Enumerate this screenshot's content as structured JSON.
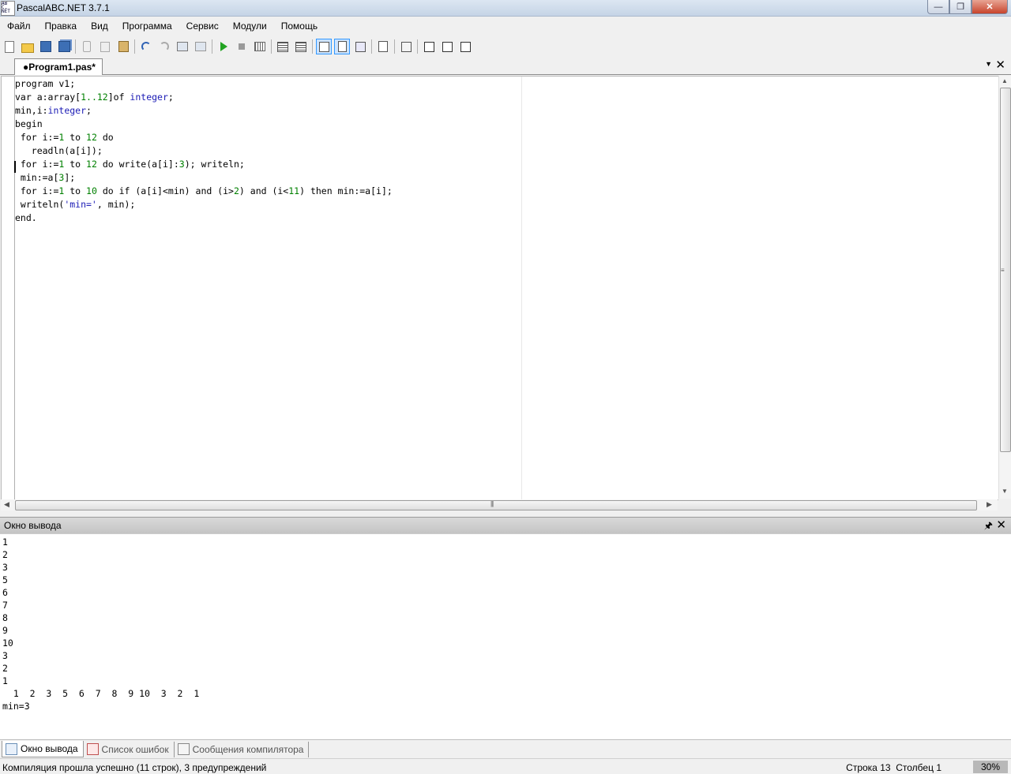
{
  "window": {
    "title": "PascalABC.NET 3.7.1",
    "icon_text": [
      "AB",
      "C.",
      "NET"
    ]
  },
  "menu": [
    "Файл",
    "Правка",
    "Вид",
    "Программа",
    "Сервис",
    "Модули",
    "Помощь"
  ],
  "toolbar": [
    "new-file-icon",
    "open-file-icon",
    "save-icon",
    "save-all-icon",
    "|",
    "cut-icon",
    "copy-icon",
    "paste-icon",
    "|",
    "undo-icon",
    "redo-icon",
    "nav-back-icon",
    "nav-forward-icon",
    "|",
    "run-icon",
    "stop-icon",
    "debug-icon",
    "|",
    "step-over-icon",
    "step-into-icon",
    "|",
    "output-console-icon",
    "output-window-icon",
    "format-code-icon",
    "|",
    "add-watch-icon",
    "|",
    "compile-all-icon",
    "|",
    "tools-1-icon",
    "tools-2-icon",
    "tools-3-icon"
  ],
  "editor": {
    "tab_label": "●Program1.pas*",
    "lines": [
      [
        [
          "program v1;",
          "kw"
        ]
      ],
      [
        [
          "var a:array[",
          "kw"
        ],
        [
          "1..12",
          "nm"
        ],
        [
          "]of ",
          "kw"
        ],
        [
          "integer",
          "ty"
        ],
        [
          ";",
          "kw"
        ]
      ],
      [
        [
          "min,i:",
          "kw"
        ],
        [
          "integer",
          "ty"
        ],
        [
          ";",
          "kw"
        ]
      ],
      [
        [
          "begin",
          "kw"
        ]
      ],
      [
        [
          " for i:=",
          "kw"
        ],
        [
          "1",
          "nm"
        ],
        [
          " to ",
          "kw"
        ],
        [
          "12",
          "nm"
        ],
        [
          " do",
          "kw"
        ]
      ],
      [
        [
          "   readln(a[i]);",
          "kw"
        ]
      ],
      [
        [
          " for i:=",
          "kw"
        ],
        [
          "1",
          "nm"
        ],
        [
          " to ",
          "kw"
        ],
        [
          "12",
          "nm"
        ],
        [
          " do write(a[i]:",
          "kw"
        ],
        [
          "3",
          "nm"
        ],
        [
          "); writeln;",
          "kw"
        ]
      ],
      [
        [
          " min:=a[",
          "kw"
        ],
        [
          "3",
          "nm"
        ],
        [
          "];",
          "kw"
        ]
      ],
      [
        [
          " for i:=",
          "kw"
        ],
        [
          "1",
          "nm"
        ],
        [
          " to ",
          "kw"
        ],
        [
          "10",
          "nm"
        ],
        [
          " do if (a[i]<min) and (i>",
          "kw"
        ],
        [
          "2",
          "nm"
        ],
        [
          ") and (i<",
          "kw"
        ],
        [
          "11",
          "nm"
        ],
        [
          ") then min:=a[i];",
          "kw"
        ]
      ],
      [
        [
          " writeln(",
          "kw"
        ],
        [
          "'min='",
          "st"
        ],
        [
          ", min);",
          "kw"
        ]
      ],
      [
        [
          "end.",
          "kw"
        ]
      ],
      [
        [
          "",
          "kw"
        ]
      ],
      [
        [
          "",
          "kw"
        ]
      ]
    ]
  },
  "output": {
    "title": "Окно вывода",
    "text": "1\n2\n3\n5\n6\n7\n8\n9\n10\n3\n2\n1\n  1  2  3  5  6  7  8  9 10  3  2  1\nmin=3"
  },
  "bottom_tabs": [
    "Окно вывода",
    "Список ошибок",
    "Сообщения компилятора"
  ],
  "status": {
    "message": "Компиляция прошла успешно (11 строк), 3 предупреждений",
    "line_label": "Строка",
    "line": "13",
    "col_label": "Столбец",
    "col": "1",
    "zoom": "30%"
  },
  "colors": {
    "keyword": "#000000",
    "type": "#1b1bb5",
    "number": "#008000",
    "string": "#1b1bb5"
  }
}
